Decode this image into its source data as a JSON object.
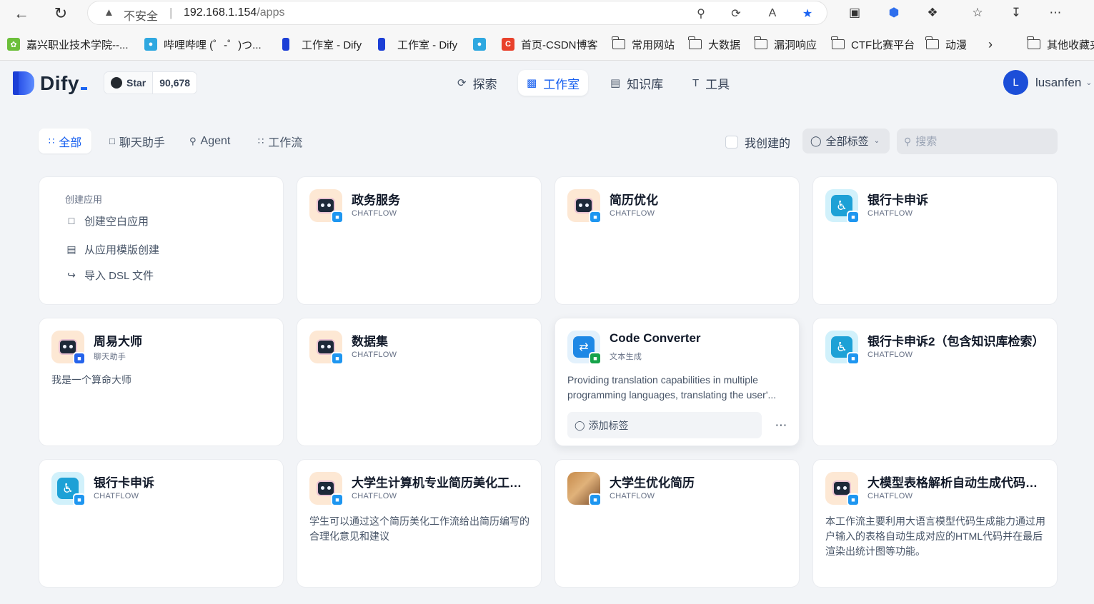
{
  "browser": {
    "insecure_label": "不安全",
    "url_host": "192.168.1.154",
    "url_path": "/apps",
    "bookmarks": [
      {
        "label": "嘉兴职业技术学院--..."
      },
      {
        "label": "哔哩哔哩 (゜-゜)つ..."
      },
      {
        "label": "工作室 - Dify"
      },
      {
        "label": "工作室 - Dify"
      },
      {
        "label": ""
      },
      {
        "label": "首页-CSDN博客"
      },
      {
        "label": "常用网站"
      },
      {
        "label": "大数据"
      },
      {
        "label": "漏洞响应"
      },
      {
        "label": "CTF比赛平台"
      },
      {
        "label": "动漫"
      },
      {
        "label": "其他收藏夹"
      }
    ]
  },
  "header": {
    "logo_text": "Dify",
    "star_label": "Star",
    "star_count": "90,678",
    "nav": [
      {
        "label": "探索",
        "icon": "compass-icon"
      },
      {
        "label": "工作室",
        "icon": "robot-icon",
        "active": true
      },
      {
        "label": "知识库",
        "icon": "book-icon"
      },
      {
        "label": "工具",
        "icon": "hammer-icon"
      }
    ],
    "user": {
      "initial": "L",
      "name": "lusanfen"
    }
  },
  "filters": {
    "tabs": [
      {
        "label": "全部",
        "active": true
      },
      {
        "label": "聊天助手"
      },
      {
        "label": "Agent"
      },
      {
        "label": "工作流"
      }
    ],
    "mine_label": "我创建的",
    "tag_select": "全部标签",
    "search_placeholder": "搜索"
  },
  "create": {
    "title": "创建应用",
    "items": [
      "创建空白应用",
      "从应用模版创建",
      "导入 DSL 文件"
    ]
  },
  "apps": [
    {
      "name": "政务服务",
      "type": "CHATFLOW",
      "icon": "robot",
      "desc": ""
    },
    {
      "name": "简历优化",
      "type": "CHATFLOW",
      "icon": "robot",
      "desc": ""
    },
    {
      "name": "银行卡申诉",
      "type": "CHATFLOW",
      "icon": "accessibility",
      "desc": ""
    },
    {
      "name": "周易大师",
      "type": "聊天助手",
      "icon": "robot",
      "desc": "我是一个算命大师"
    },
    {
      "name": "数据集",
      "type": "CHATFLOW",
      "icon": "robot",
      "desc": ""
    },
    {
      "name": "Code Converter",
      "type": "文本生成",
      "icon": "code",
      "desc": "Providing translation capabilities in multiple programming languages, translating the user'...",
      "tag_label": "添加标签"
    },
    {
      "name": "银行卡申诉2（包含知识库检索）",
      "type": "CHATFLOW",
      "icon": "accessibility",
      "desc": ""
    },
    {
      "name": "银行卡申诉",
      "type": "CHATFLOW",
      "icon": "accessibility",
      "desc": ""
    },
    {
      "name": "大学生计算机专业简历美化工作流",
      "type": "CHATFLOW",
      "icon": "robot",
      "desc": "学生可以通过这个简历美化工作流给出简历编写的合理化意见和建议"
    },
    {
      "name": "大学生优化简历",
      "type": "CHATFLOW",
      "icon": "photo",
      "desc": ""
    },
    {
      "name": "大模型表格解析自动生成代码生...",
      "type": "CHATFLOW",
      "icon": "robot",
      "desc": "本工作流主要利用大语言模型代码生成能力通过用户输入的表格自动生成对应的HTML代码并在最后渲染出统计图等功能。"
    }
  ]
}
